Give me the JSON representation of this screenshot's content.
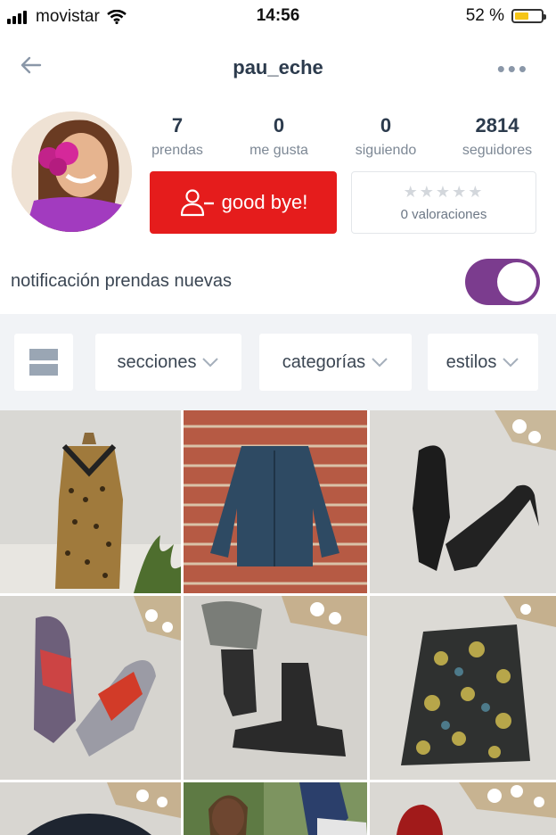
{
  "status": {
    "carrier": "movistar",
    "time": "14:56",
    "battery": "52 %",
    "battery_level": 0.52
  },
  "nav": {
    "title": "pau_eche",
    "more": "•••"
  },
  "profile": {
    "stats": [
      {
        "value": "7",
        "label": "prendas"
      },
      {
        "value": "0",
        "label": "me gusta"
      },
      {
        "value": "0",
        "label": "siguiendo"
      },
      {
        "value": "2814",
        "label": "seguidores"
      }
    ],
    "follow_button": "good bye!",
    "stars": "★★★★★",
    "ratings_label": "0 valoraciones"
  },
  "notification": {
    "label": "notificación prendas nuevas",
    "enabled": true
  },
  "filters": {
    "sections": "secciones",
    "categories": "categorías",
    "styles": "estilos"
  },
  "products": [
    {
      "name": "leopard-print-dress"
    },
    {
      "name": "denim-jacket"
    },
    {
      "name": "black-mule-heels"
    },
    {
      "name": "sneakers"
    },
    {
      "name": "ankle-boots"
    },
    {
      "name": "floral-skirt"
    },
    {
      "name": "dark-top"
    },
    {
      "name": "woman-photo"
    },
    {
      "name": "red-shoe"
    }
  ],
  "colors": {
    "accent_red": "#e51c1c",
    "toggle_purple": "#7b3c8e",
    "text": "#2c3b4d"
  }
}
